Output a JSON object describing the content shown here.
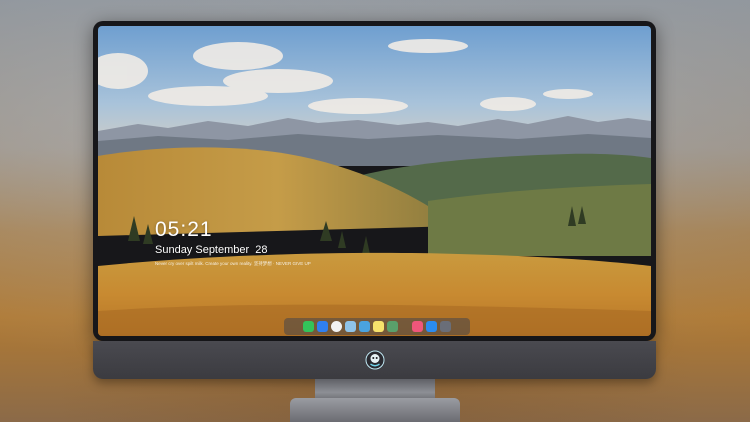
{
  "lockscreen": {
    "time": "05:21",
    "date": "Sunday September  28",
    "quote": "Never cry over spilt milk. Create your own reality. 坚持梦想 · NEVER GIVE UP"
  },
  "dock": {
    "apps": [
      {
        "name": "messages-icon",
        "color": "#33c35a"
      },
      {
        "name": "weather-icon",
        "color": "#2f7ff0"
      },
      {
        "name": "clock-icon",
        "color": "#f2f2f2"
      },
      {
        "name": "photos-icon",
        "color": "#8fc3e8"
      },
      {
        "name": "clapper-icon",
        "color": "#4aa3df"
      },
      {
        "name": "notes-icon",
        "color": "#f7e26b"
      },
      {
        "name": "image-viewer-icon",
        "color": "#5aa06b"
      },
      {
        "name": "music-icon",
        "color": "#f0567a"
      },
      {
        "name": "app-store-icon",
        "color": "#2b8cf0"
      },
      {
        "name": "camera-icon",
        "color": "#6a6e78"
      }
    ]
  },
  "colors": {
    "bezel": "#17171a",
    "chin": "#3f3f45",
    "stand": "#8d8f95"
  }
}
